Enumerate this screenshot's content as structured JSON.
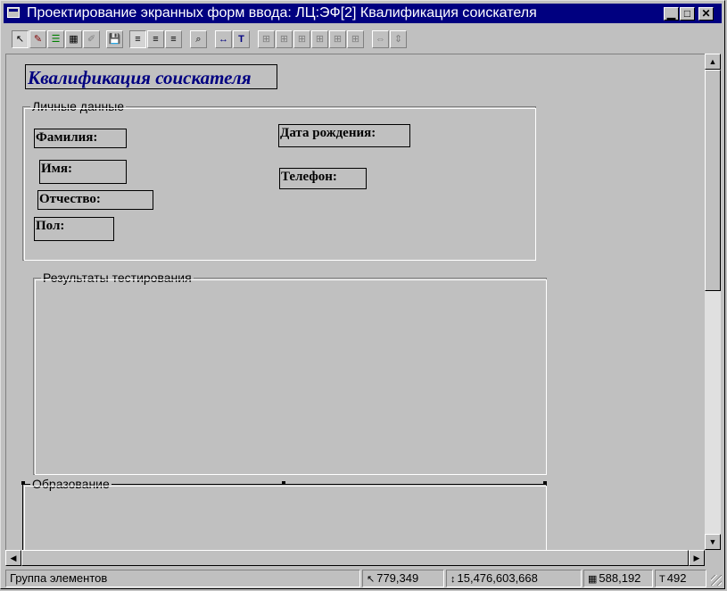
{
  "window": {
    "title": "Проектирование экранных форм ввода: ЛЦ:ЭФ[2] Квалификация соискателя",
    "min_glyph": "▁",
    "max_glyph": "□",
    "close_glyph": "✕"
  },
  "toolbar": {
    "pointer": "↖",
    "edit": "✎",
    "list": "☰",
    "grid": "▦",
    "disabled_tool": "✐",
    "save": "💾",
    "align_left": "≡",
    "align_center": "≡",
    "align_right": "≡",
    "zoom": "⌕",
    "min_size": "↔",
    "text_tool": "T",
    "arrange1": "⊞",
    "arrange2": "⊞",
    "arrange3": "⊞",
    "arrange4": "⊞",
    "arrange5": "⊞",
    "arrange6": "⊞",
    "width_tool": "⇔",
    "height_tool": "⇕"
  },
  "form": {
    "title": "Квалификация соискателя",
    "groups": {
      "personal": {
        "legend": "Личные данные",
        "fields": {
          "lastname": "Фамилия:",
          "firstname": "Имя:",
          "patronymic": "Отчество:",
          "gender": "Пол:",
          "birthdate": "Дата рождения:",
          "phone": "Телефон:"
        }
      },
      "tests": {
        "legend": "Результаты тестирования"
      },
      "education": {
        "legend": "Образование"
      }
    }
  },
  "scroll": {
    "up": "▲",
    "down": "▼",
    "left": "◀",
    "right": "▶"
  },
  "status": {
    "message": "Группа элементов",
    "cursor_icon": "↖",
    "cursor_pos": "779,349",
    "bounds_icon": "↕",
    "bounds": "15,476,603,668",
    "size_icon": "▦",
    "size": "588,192",
    "count_icon": "T",
    "count": "492"
  }
}
